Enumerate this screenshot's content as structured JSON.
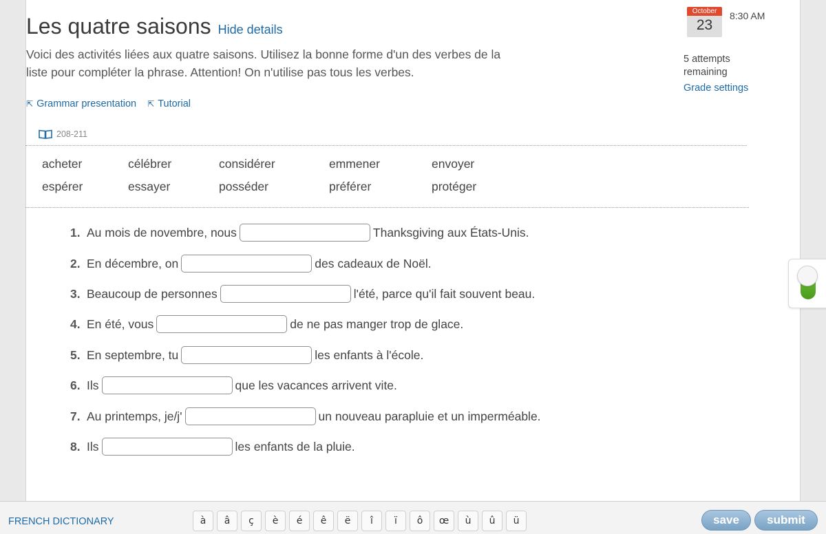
{
  "header": {
    "title": "Les quatre saisons",
    "hide_details": "Hide details",
    "instructions": "Voici des activités liées aux quatre saisons. Utilisez la bonne forme d'un des verbes de la liste pour compléter la phrase. Attention! On n'utilise pas tous les verbes."
  },
  "links": {
    "grammar": "Grammar presentation",
    "tutorial": "Tutorial"
  },
  "pageref": "208-211",
  "meta": {
    "month": "October",
    "day": "23",
    "time": "8:30 AM",
    "attempts": "5 attempts remaining",
    "grade_settings": "Grade settings"
  },
  "word_bank": [
    "acheter",
    "célébrer",
    "considérer",
    "emmener",
    "envoyer",
    "espérer",
    "essayer",
    "posséder",
    "préférer",
    "protéger"
  ],
  "questions": [
    {
      "num": "1.",
      "before": "Au mois de novembre, nous",
      "after": "Thanksgiving aux États-Unis."
    },
    {
      "num": "2.",
      "before": "En décembre, on",
      "after": "des cadeaux de Noël."
    },
    {
      "num": "3.",
      "before": "Beaucoup de personnes",
      "after": "l'été, parce qu'il fait souvent beau."
    },
    {
      "num": "4.",
      "before": "En été, vous",
      "after": "de ne pas manger trop de glace."
    },
    {
      "num": "5.",
      "before": "En septembre, tu",
      "after": "les enfants à l'école."
    },
    {
      "num": "6.",
      "before": "Ils",
      "after": "que les vacances arrivent vite."
    },
    {
      "num": "7.",
      "before": "Au printemps, je/j'",
      "after": "un nouveau parapluie et un imperméable."
    },
    {
      "num": "8.",
      "before": "Ils",
      "after": "les enfants de la pluie."
    }
  ],
  "footer": {
    "dictionary": "FRENCH DICTIONARY",
    "accents": [
      "à",
      "â",
      "ç",
      "è",
      "é",
      "ê",
      "ë",
      "î",
      "ï",
      "ô",
      "œ",
      "ù",
      "û",
      "ü"
    ],
    "save": "save",
    "submit": "submit"
  }
}
